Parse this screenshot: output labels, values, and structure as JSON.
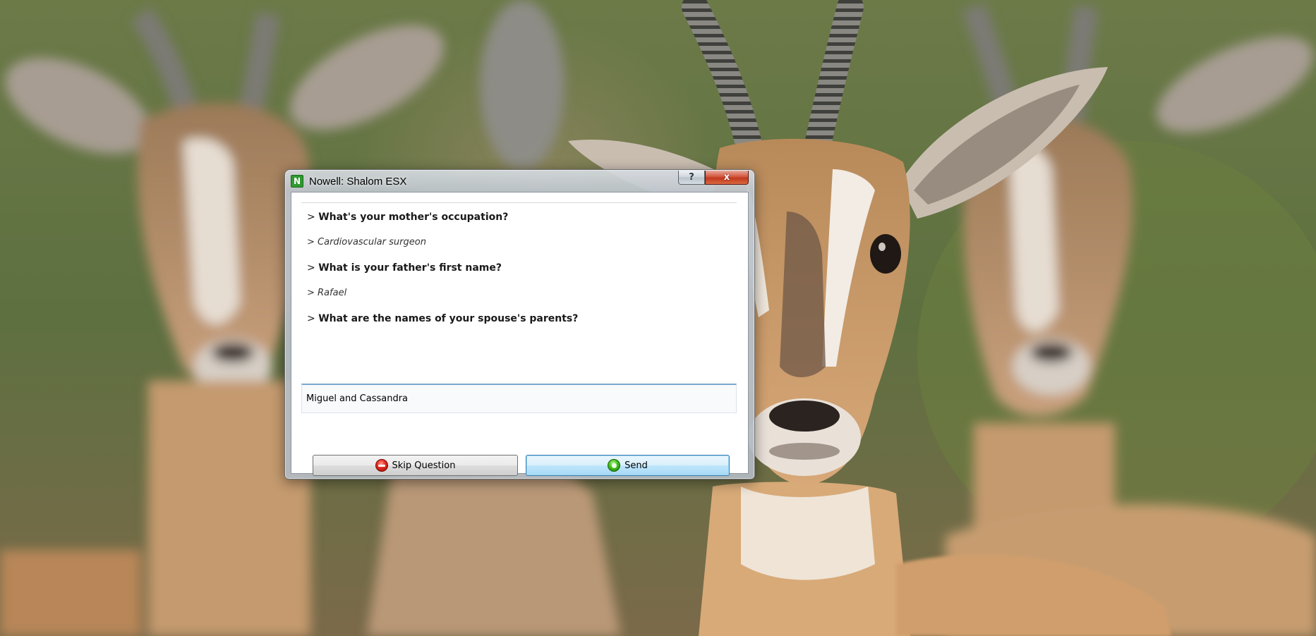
{
  "window": {
    "app_icon_letter": "N",
    "title": "Nowell: Shalom ESX",
    "help_label": "?",
    "close_label": "x"
  },
  "transcript": [
    {
      "kind": "question",
      "prefix": ">",
      "text": "What's your mother's occupation?"
    },
    {
      "kind": "answer",
      "prefix": ">",
      "text": "Cardiovascular surgeon"
    },
    {
      "kind": "question",
      "prefix": ">",
      "text": "What is your father's first name?"
    },
    {
      "kind": "answer",
      "prefix": ">",
      "text": "Rafael"
    },
    {
      "kind": "question",
      "prefix": ">",
      "text": "What are the names of your spouse's parents?"
    }
  ],
  "answer_input": {
    "value": "Miguel and Cassandra"
  },
  "buttons": {
    "skip_label": "Skip Question",
    "skip_icon": "red-stop-orb-icon",
    "send_label": "Send",
    "send_icon": "green-go-orb-icon"
  },
  "colors": {
    "close_button": "#c2381f",
    "app_icon": "#2f9a2f",
    "send_button_border": "#3c7fb1"
  }
}
